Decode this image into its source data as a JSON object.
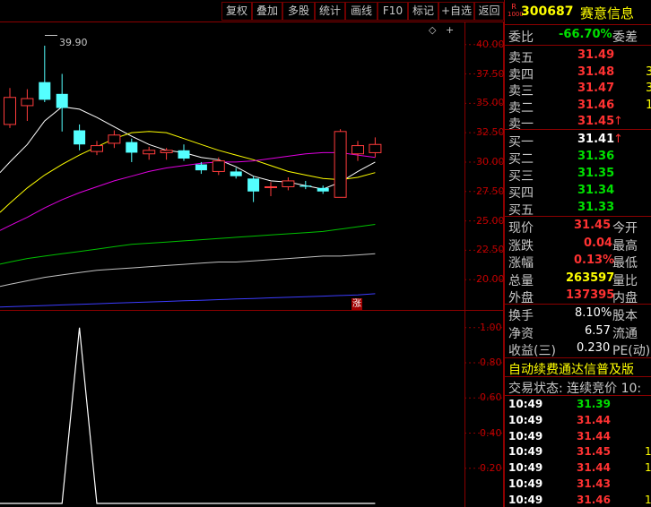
{
  "toolbar": {
    "buttons": [
      "复权",
      "叠加",
      "多股",
      "统计",
      "画线",
      "F10",
      "标记",
      "+自选",
      "返回"
    ]
  },
  "chart": {
    "high_label": "39.90",
    "limit_up_marker": "涨",
    "price_axis": [
      "40.00",
      "37.50",
      "35.00",
      "32.50",
      "30.00",
      "27.50",
      "25.00",
      "22.50",
      "20.00"
    ],
    "volume_axis": [
      "1.00",
      "0.80",
      "0.60",
      "0.40",
      "0.20"
    ]
  },
  "chart_data": {
    "type": "candlestick",
    "ylim": [
      17.5,
      41.5
    ],
    "candles": [
      {
        "o": 33.2,
        "c": 35.5,
        "h": 36.3,
        "l": 32.9
      },
      {
        "o": 34.8,
        "c": 35.4,
        "h": 36.2,
        "l": 33.5
      },
      {
        "o": 36.8,
        "c": 35.3,
        "h": 39.9,
        "l": 35.1
      },
      {
        "o": 35.8,
        "c": 34.6,
        "h": 37.5,
        "l": 32.6
      },
      {
        "o": 32.7,
        "c": 31.5,
        "h": 33.2,
        "l": 31.0
      },
      {
        "o": 30.9,
        "c": 31.4,
        "h": 31.8,
        "l": 30.6
      },
      {
        "o": 31.6,
        "c": 32.3,
        "h": 32.7,
        "l": 31.2
      },
      {
        "o": 31.7,
        "c": 30.8,
        "h": 32.0,
        "l": 30.0
      },
      {
        "o": 30.7,
        "c": 31.0,
        "h": 31.3,
        "l": 30.2
      },
      {
        "o": 30.8,
        "c": 31.0,
        "h": 31.2,
        "l": 30.2
      },
      {
        "o": 31.0,
        "c": 30.3,
        "h": 31.5,
        "l": 30.1
      },
      {
        "o": 29.8,
        "c": 29.3,
        "h": 30.0,
        "l": 29.0
      },
      {
        "o": 29.2,
        "c": 30.1,
        "h": 30.4,
        "l": 28.9
      },
      {
        "o": 29.2,
        "c": 28.8,
        "h": 29.5,
        "l": 28.6
      },
      {
        "o": 28.6,
        "c": 27.5,
        "h": 28.8,
        "l": 26.6
      },
      {
        "o": 27.9,
        "c": 27.9,
        "h": 28.3,
        "l": 27.1
      },
      {
        "o": 27.9,
        "c": 28.4,
        "h": 28.7,
        "l": 27.6
      },
      {
        "o": 28.0,
        "c": 27.9,
        "h": 28.4,
        "l": 27.7
      },
      {
        "o": 27.8,
        "c": 27.5,
        "h": 28.0,
        "l": 27.3
      },
      {
        "o": 27.0,
        "c": 32.6,
        "h": 32.8,
        "l": 27.0
      },
      {
        "o": 30.7,
        "c": 31.4,
        "h": 31.8,
        "l": 30.1
      },
      {
        "o": 30.8,
        "c": 31.5,
        "h": 32.1,
        "l": 30.4
      }
    ],
    "ma": [
      {
        "color": "#ffffff",
        "values": [
          30.0,
          31.5,
          33.5,
          34.7,
          34.5,
          33.8,
          33.0,
          32.2,
          31.5,
          31.0,
          30.8,
          30.4,
          30.2,
          29.6,
          28.8,
          28.4,
          28.3,
          28.0,
          27.7,
          28.3,
          29.2,
          30.0
        ]
      },
      {
        "color": "#ffff00",
        "values": [
          26.5,
          27.8,
          28.9,
          29.8,
          30.6,
          31.3,
          32.0,
          32.5,
          32.6,
          32.5,
          32.0,
          31.5,
          31.0,
          30.6,
          30.2,
          29.7,
          29.2,
          28.9,
          28.6,
          28.5,
          28.7,
          29.1
        ]
      },
      {
        "color": "#e000e0",
        "values": [
          24.6,
          25.3,
          26.1,
          26.8,
          27.4,
          27.9,
          28.4,
          28.8,
          29.2,
          29.5,
          29.7,
          29.9,
          30.0,
          30.0,
          30.1,
          30.3,
          30.5,
          30.7,
          30.8,
          30.8,
          30.6,
          30.4
        ]
      },
      {
        "color": "#00c000",
        "values": [
          21.5,
          21.8,
          22.0,
          22.2,
          22.4,
          22.6,
          22.8,
          23.0,
          23.1,
          23.2,
          23.3,
          23.4,
          23.5,
          23.6,
          23.7,
          23.8,
          23.9,
          24.0,
          24.1,
          24.3,
          24.5,
          24.7
        ]
      },
      {
        "color": "#c0c0c0",
        "values": [
          19.6,
          19.9,
          20.2,
          20.4,
          20.6,
          20.8,
          20.9,
          21.0,
          21.1,
          21.2,
          21.3,
          21.4,
          21.5,
          21.5,
          21.6,
          21.7,
          21.8,
          21.9,
          22.0,
          22.0,
          22.1,
          22.2
        ]
      },
      {
        "color": "#3c3cff",
        "values": [
          17.7,
          17.75,
          17.8,
          17.85,
          17.9,
          17.95,
          18.0,
          18.05,
          18.1,
          18.15,
          18.2,
          18.25,
          18.3,
          18.35,
          18.4,
          18.45,
          18.5,
          18.55,
          18.6,
          18.65,
          18.7,
          18.8
        ]
      }
    ],
    "volume_ylim": [
      0,
      1.05
    ],
    "volume": [
      0,
      0,
      0,
      0,
      1.0,
      0,
      0,
      0,
      0,
      0,
      0,
      0,
      0,
      0,
      0,
      0,
      0,
      0,
      0,
      0,
      0,
      0
    ]
  },
  "quote": {
    "code": "300687",
    "name": "赛意信息",
    "badge_top": "R",
    "badge_bottom": "1000",
    "weibi_label": "委比",
    "weibi_value": "-66.70%",
    "weicha_label": "委差",
    "asks": [
      {
        "label": "卖五",
        "price": "31.49",
        "vol": ""
      },
      {
        "label": "卖四",
        "price": "31.48",
        "vol": "3"
      },
      {
        "label": "卖三",
        "price": "31.47",
        "vol": "3"
      },
      {
        "label": "卖二",
        "price": "31.46",
        "vol": "1"
      },
      {
        "label": "卖一",
        "price": "31.45",
        "arrow": "↑"
      }
    ],
    "bids": [
      {
        "label": "买一",
        "price": "31.41",
        "arrow": "↑",
        "color": "white"
      },
      {
        "label": "买二",
        "price": "31.36",
        "color": "green"
      },
      {
        "label": "买三",
        "price": "31.35",
        "color": "green"
      },
      {
        "label": "买四",
        "price": "31.34",
        "color": "green"
      },
      {
        "label": "买五",
        "price": "31.33",
        "color": "green"
      }
    ],
    "stats": [
      {
        "label": "现价",
        "value": "31.45",
        "color": "red",
        "label2": "今开"
      },
      {
        "label": "涨跌",
        "value": "0.04",
        "color": "red",
        "label2": "最高"
      },
      {
        "label": "涨幅",
        "value": "0.13%",
        "color": "red",
        "label2": "最低"
      },
      {
        "label": "总量",
        "value": "263597",
        "color": "yellow",
        "label2": "量比"
      },
      {
        "label": "外盘",
        "value": "137395",
        "color": "red",
        "label2": "内盘"
      }
    ],
    "stats2": [
      {
        "label": "换手",
        "value": "8.10%",
        "label2": "股本"
      },
      {
        "label": "净资",
        "value": "6.57",
        "label2": "流通"
      },
      {
        "label": "收益(三)",
        "value": "0.230",
        "label2": "PE(动)"
      }
    ],
    "ticker": "自动续费通达信普及版",
    "status": "交易状态: 连续竞价 10:",
    "ticks": [
      {
        "time": "10:49",
        "price": "31.39",
        "color": "green",
        "tail": ""
      },
      {
        "time": "10:49",
        "price": "31.44",
        "color": "red",
        "tail": ""
      },
      {
        "time": "10:49",
        "price": "31.44",
        "color": "red",
        "tail": ""
      },
      {
        "time": "10:49",
        "price": "31.45",
        "color": "red",
        "tail": "1"
      },
      {
        "time": "10:49",
        "price": "31.44",
        "color": "red",
        "tail": "1"
      },
      {
        "time": "10:49",
        "price": "31.43",
        "color": "red",
        "tail": ""
      },
      {
        "time": "10:49",
        "price": "31.46",
        "color": "red",
        "tail": "1"
      }
    ]
  }
}
